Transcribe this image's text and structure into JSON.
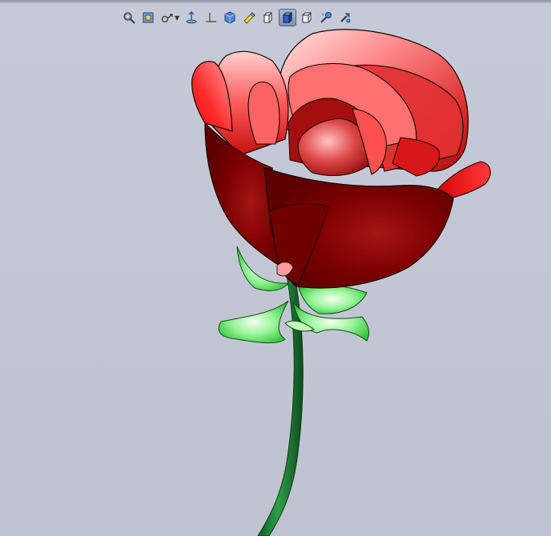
{
  "viewport": {
    "background_color": "#c3c7d3",
    "model": {
      "petal_color_dark": "#7a0000",
      "petal_color_light": "#ff6a6a",
      "stem_color": "#1f7a32",
      "leaf_color": "#7cf07a"
    }
  },
  "heads_up_toolbar": {
    "items": [
      {
        "name": "zoom-to-fit-icon"
      },
      {
        "name": "zoom-to-area-icon"
      },
      {
        "name": "previous-view-icon"
      },
      {
        "name": "section-view-icon"
      },
      {
        "name": "view-orientation-icon"
      },
      {
        "name": "display-style-icon"
      },
      {
        "name": "hide-show-items-icon"
      },
      {
        "name": "edit-appearance-icon"
      },
      {
        "name": "apply-scene-icon"
      },
      {
        "name": "view-settings-icon"
      },
      {
        "name": "wireframe-icon"
      },
      {
        "name": "shaded-with-edges-icon",
        "active": true
      },
      {
        "name": "shaded-icon"
      },
      {
        "name": "rotate-view-icon"
      },
      {
        "name": "pan-view-icon"
      }
    ]
  }
}
